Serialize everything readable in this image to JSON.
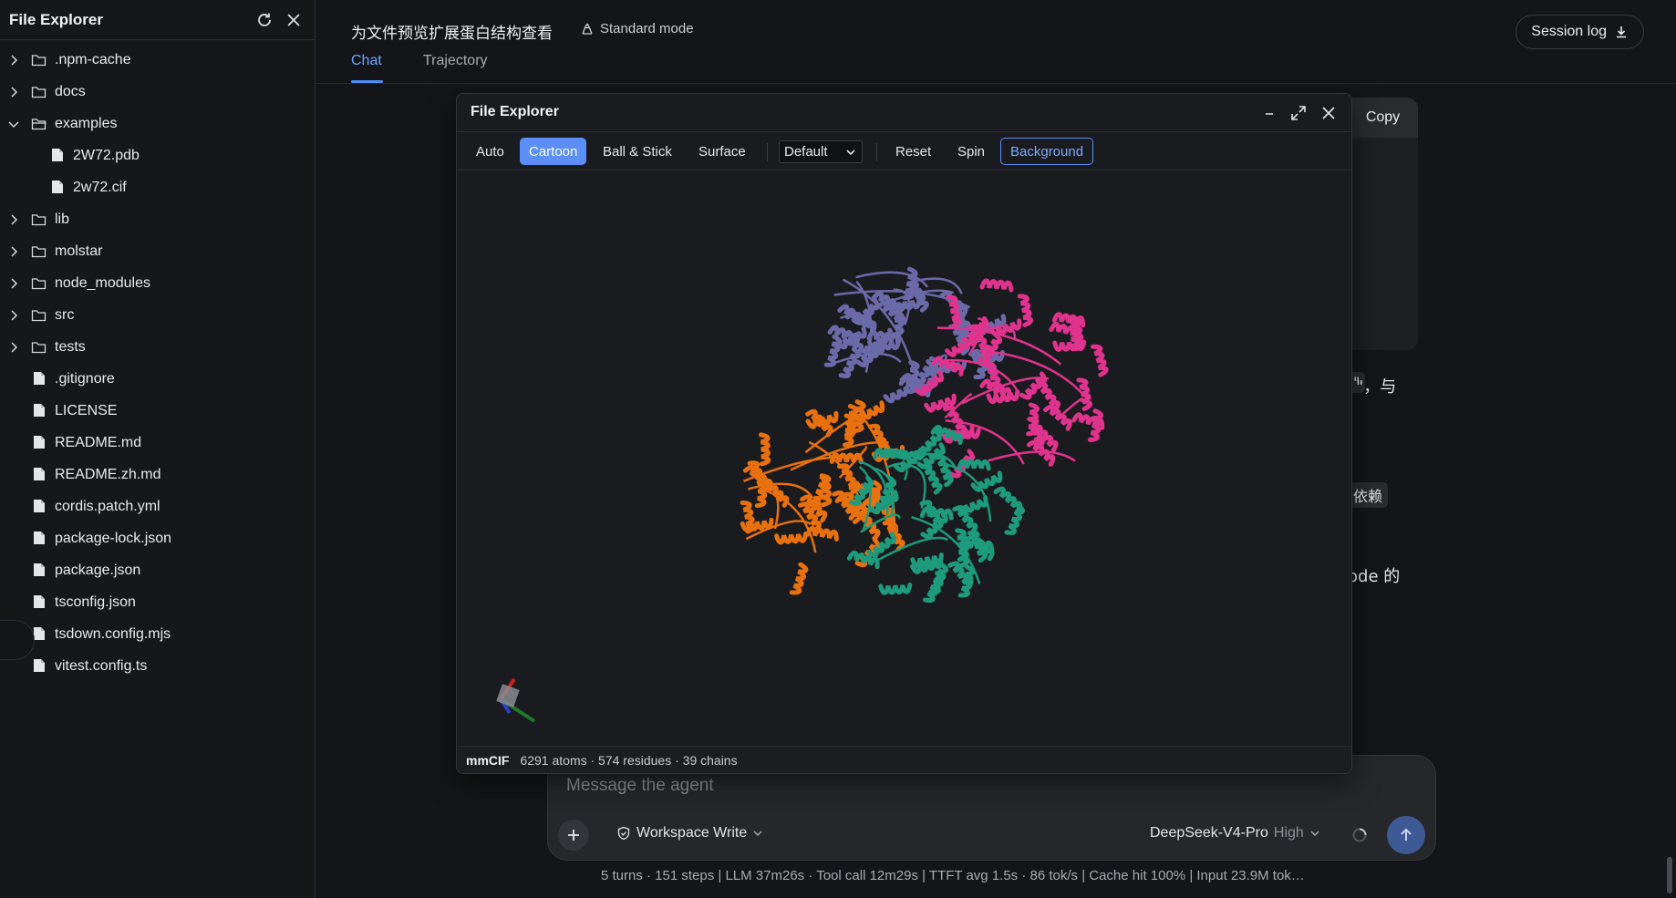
{
  "sidebar": {
    "title": "File Explorer",
    "items": [
      {
        "label": ".npm-cache",
        "kind": "folder",
        "expanded": false,
        "depth": 0
      },
      {
        "label": "docs",
        "kind": "folder",
        "expanded": false,
        "depth": 0
      },
      {
        "label": "examples",
        "kind": "folder",
        "expanded": true,
        "depth": 0
      },
      {
        "label": "2W72.pdb",
        "kind": "file",
        "depth": 1
      },
      {
        "label": "2w72.cif",
        "kind": "file",
        "depth": 1
      },
      {
        "label": "lib",
        "kind": "folder",
        "expanded": false,
        "depth": 0
      },
      {
        "label": "molstar",
        "kind": "folder",
        "expanded": false,
        "depth": 0
      },
      {
        "label": "node_modules",
        "kind": "folder",
        "expanded": false,
        "depth": 0
      },
      {
        "label": "src",
        "kind": "folder",
        "expanded": false,
        "depth": 0
      },
      {
        "label": "tests",
        "kind": "folder",
        "expanded": false,
        "depth": 0
      },
      {
        "label": ".gitignore",
        "kind": "file",
        "depth": 0
      },
      {
        "label": "LICENSE",
        "kind": "file",
        "depth": 0
      },
      {
        "label": "README.md",
        "kind": "file",
        "depth": 0
      },
      {
        "label": "README.zh.md",
        "kind": "file",
        "depth": 0
      },
      {
        "label": "cordis.patch.yml",
        "kind": "file",
        "depth": 0
      },
      {
        "label": "package-lock.json",
        "kind": "file",
        "depth": 0
      },
      {
        "label": "package.json",
        "kind": "file",
        "depth": 0
      },
      {
        "label": "tsconfig.json",
        "kind": "file",
        "depth": 0
      },
      {
        "label": "tsdown.config.mjs",
        "kind": "file",
        "depth": 0
      },
      {
        "label": "vitest.config.ts",
        "kind": "file",
        "depth": 0
      }
    ]
  },
  "header": {
    "title": "为文件预览扩展蛋白结构查看",
    "mode_label": "Standard mode",
    "tabs": [
      {
        "label": "Chat",
        "active": true
      },
      {
        "label": "Trajectory",
        "active": false
      }
    ],
    "session_log_label": "Session log"
  },
  "chat": {
    "copy_label": "Copy",
    "frag_1": "\"，与",
    "frag_2": "依赖",
    "frag_3": "ode 的"
  },
  "viewer": {
    "title": "File Explorer",
    "toolbar": {
      "auto": "Auto",
      "cartoon": "Cartoon",
      "ball_stick": "Ball & Stick",
      "surface": "Surface",
      "color_scheme": "Default",
      "reset": "Reset",
      "spin": "Spin",
      "background": "Background"
    },
    "status": {
      "format": "mmCIF",
      "summary": "6291 atoms · 574 residues · 39 chains"
    },
    "chain_colors": [
      "#6b6aa8",
      "#e0338d",
      "#e8700f",
      "#1e9a7c"
    ]
  },
  "composer": {
    "placeholder": "Message the agent",
    "workspace": "Workspace Write",
    "model": "DeepSeek-V4-Pro",
    "level": "High"
  },
  "stats": "5 turns · 151 steps   |   LLM 37m26s · Tool call 12m29s   |   TTFT avg 1.5s · 86 tok/s   |   Cache hit 100%   |   Input 23.9M tok…",
  "colors": {
    "accent": "#5b8ff5",
    "background": "#141518"
  }
}
